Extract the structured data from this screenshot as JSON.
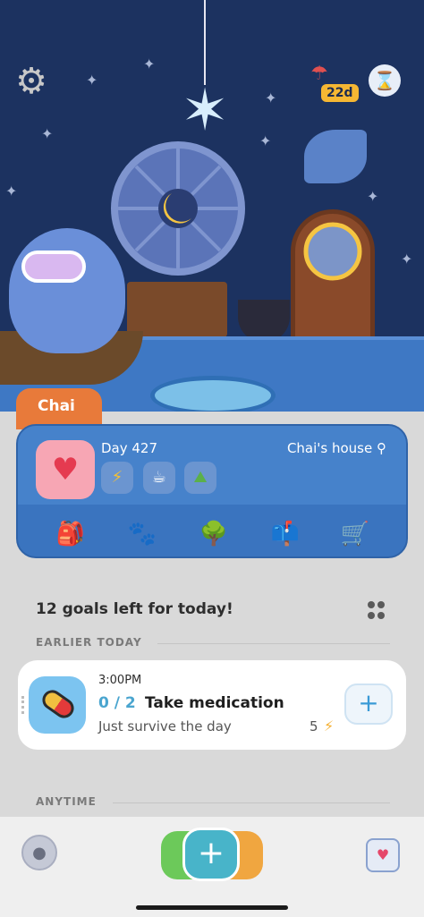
{
  "status": {
    "streak_days": "22d"
  },
  "pet": {
    "name": "Chai",
    "day": "Day 427",
    "location": "Chai's house"
  },
  "card_nav": [
    {
      "name": "backpack-icon",
      "glyph": "🎒"
    },
    {
      "name": "paw-prints-icon",
      "glyph": "🐾"
    },
    {
      "name": "tree-icon",
      "glyph": "🌳"
    },
    {
      "name": "mailbox-icon",
      "glyph": "📫"
    },
    {
      "name": "cart-icon",
      "glyph": "🛒"
    }
  ],
  "goals": {
    "summary": "12 goals left for today!",
    "sections": {
      "earlier": "EARLIER TODAY",
      "anytime": "ANYTIME"
    },
    "items": [
      {
        "time": "3:00PM",
        "progress": "0 / 2",
        "name": "Take medication",
        "description": "Just survive the day",
        "energy": "5"
      }
    ]
  },
  "colors": {
    "scene_bg": "#1c3260",
    "card_bg": "#3a74bf",
    "name_tab": "#e87a3a",
    "accent_teal": "#48b4c9",
    "accent_blue": "#4aa5cf"
  }
}
